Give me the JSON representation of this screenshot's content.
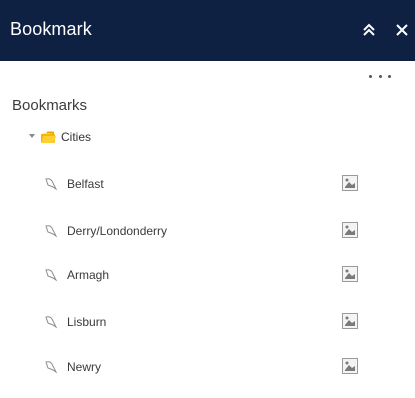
{
  "header": {
    "title": "Bookmark",
    "collapse_icon": "double-chevron-up-icon",
    "close_icon": "close-icon"
  },
  "panel": {
    "more_icon": "more-dots-icon",
    "section_title": "Bookmarks",
    "folder": {
      "label": "Cities",
      "expanded": true,
      "icon": "folder-icon"
    },
    "bookmarks": [
      {
        "label": "Belfast",
        "icon": "bookmark-icon",
        "thumbnail_icon": "image-placeholder-icon"
      },
      {
        "label": "Derry/Londonderry",
        "icon": "bookmark-icon",
        "thumbnail_icon": "image-placeholder-icon"
      },
      {
        "label": "Armagh",
        "icon": "bookmark-icon",
        "thumbnail_icon": "image-placeholder-icon"
      },
      {
        "label": "Lisburn",
        "icon": "bookmark-icon",
        "thumbnail_icon": "image-placeholder-icon"
      },
      {
        "label": "Newry",
        "icon": "bookmark-icon",
        "thumbnail_icon": "image-placeholder-icon"
      }
    ]
  },
  "colors": {
    "header_bg": "#0e2143",
    "header_text": "#ffffff",
    "folder": "#f5b700"
  }
}
